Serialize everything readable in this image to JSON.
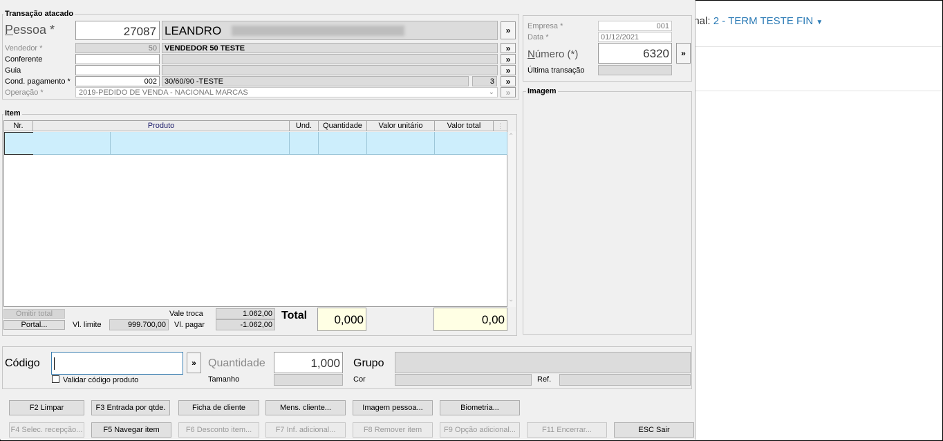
{
  "background_page": {
    "terminal_label": "inal:",
    "terminal_value": "2 - TERM TESTE FIN",
    "dropdown_icon": "caret-down-icon"
  },
  "transacao": {
    "title": "Transação atacado",
    "pessoa": {
      "label": "Pessoa *",
      "code": "27087",
      "name": "LEANDRO"
    },
    "vendedor": {
      "label": "Vendedor *",
      "code": "50",
      "name": "VENDEDOR 50 TESTE"
    },
    "conferente": {
      "label": "Conferente",
      "code": "",
      "name": ""
    },
    "guia": {
      "label": "Guia",
      "code": "",
      "name": ""
    },
    "cond_pagamento": {
      "label": "Cond. pagamento *",
      "code": "002",
      "name": "30/60/90 -TESTE",
      "parcelas": "3"
    },
    "operacao": {
      "label": "Operação *",
      "value": "2019-PEDIDO DE VENDA - NACIONAL MARCAS"
    },
    "arrow_label": "»"
  },
  "empresa": {
    "empresa_label": "Empresa *",
    "empresa_value": "001",
    "data_label": "Data *",
    "data_value": "01/12/2021",
    "numero_label": "Número (*)",
    "numero_value": "6320",
    "ultima_label": "Última transação",
    "ultima_value": ""
  },
  "imagem": {
    "title": "Imagem"
  },
  "item": {
    "title": "Item",
    "columns": [
      "Nr.",
      "Produto",
      "Und.",
      "Quantidade",
      "Valor unitário",
      "Valor total"
    ],
    "omitir_total": "Omitir total",
    "portal": "Portal...",
    "vl_limite_label": "Vl. limite",
    "vl_limite_value": "999.700,00",
    "vale_troca_label": "Vale troca",
    "vale_troca_value": "1.062,00",
    "vl_pagar_label": "Vl. pagar",
    "vl_pagar_value": "-1.062,00",
    "total_label": "Total",
    "total_quantidade": "0,000",
    "total_valor": "0,00"
  },
  "entrada": {
    "codigo_label": "Código",
    "codigo_value": "",
    "validar_label": "Validar código produto",
    "quantidade_label": "Quantidade",
    "quantidade_value": "1,000",
    "tamanho_label": "Tamanho",
    "grupo_label": "Grupo",
    "cor_label": "Cor",
    "ref_label": "Ref."
  },
  "buttons_row1": [
    "F2 Limpar",
    "F3 Entrada por qtde.",
    "Ficha de cliente",
    "Mens. cliente...",
    "Imagem pessoa...",
    "Biometria..."
  ],
  "buttons_row2": [
    "F4 Selec. recepção...",
    "F5 Navegar item",
    "F6 Desconto item...",
    "F7 Inf. adicional...",
    "F8 Remover item",
    "F9 Opção adicional...",
    "F11 Encerrar...",
    "ESC Sair"
  ]
}
